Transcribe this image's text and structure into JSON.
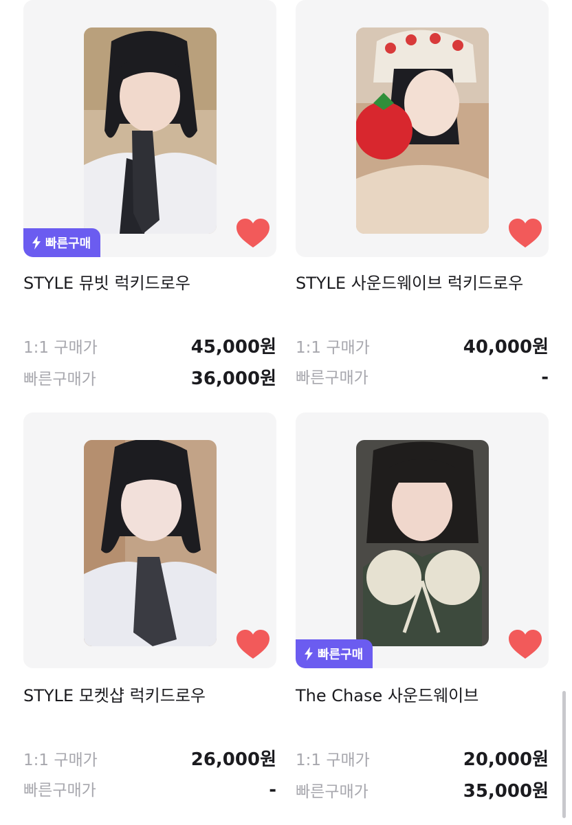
{
  "colors": {
    "badge": "#6b5cf0",
    "heart": "#f25a5a",
    "card_bg": "#f5f5f6",
    "label": "#a7a7ad",
    "text": "#1b1b1f"
  },
  "labels": {
    "one_to_one": "1:1 구매가",
    "quick": "빠른구매가",
    "badge": "빠른구매"
  },
  "products": [
    {
      "title": "STYLE 뮤빗 럭키드로우",
      "price_1to1": "45,000원",
      "price_quick": "36,000원",
      "quick_badge": true,
      "liked": true,
      "photo_icon": "photocard-image"
    },
    {
      "title": "STYLE 사운드웨이브 럭키드로우",
      "price_1to1": "40,000원",
      "price_quick": "-",
      "quick_badge": false,
      "liked": true,
      "photo_icon": "photocard-image"
    },
    {
      "title": "STYLE 모켓샵 럭키드로우",
      "price_1to1": "26,000원",
      "price_quick": "-",
      "quick_badge": false,
      "liked": true,
      "photo_icon": "photocard-image"
    },
    {
      "title": "The Chase 사운드웨이브",
      "price_1to1": "20,000원",
      "price_quick": "35,000원",
      "quick_badge": true,
      "liked": true,
      "photo_icon": "photocard-image"
    }
  ]
}
